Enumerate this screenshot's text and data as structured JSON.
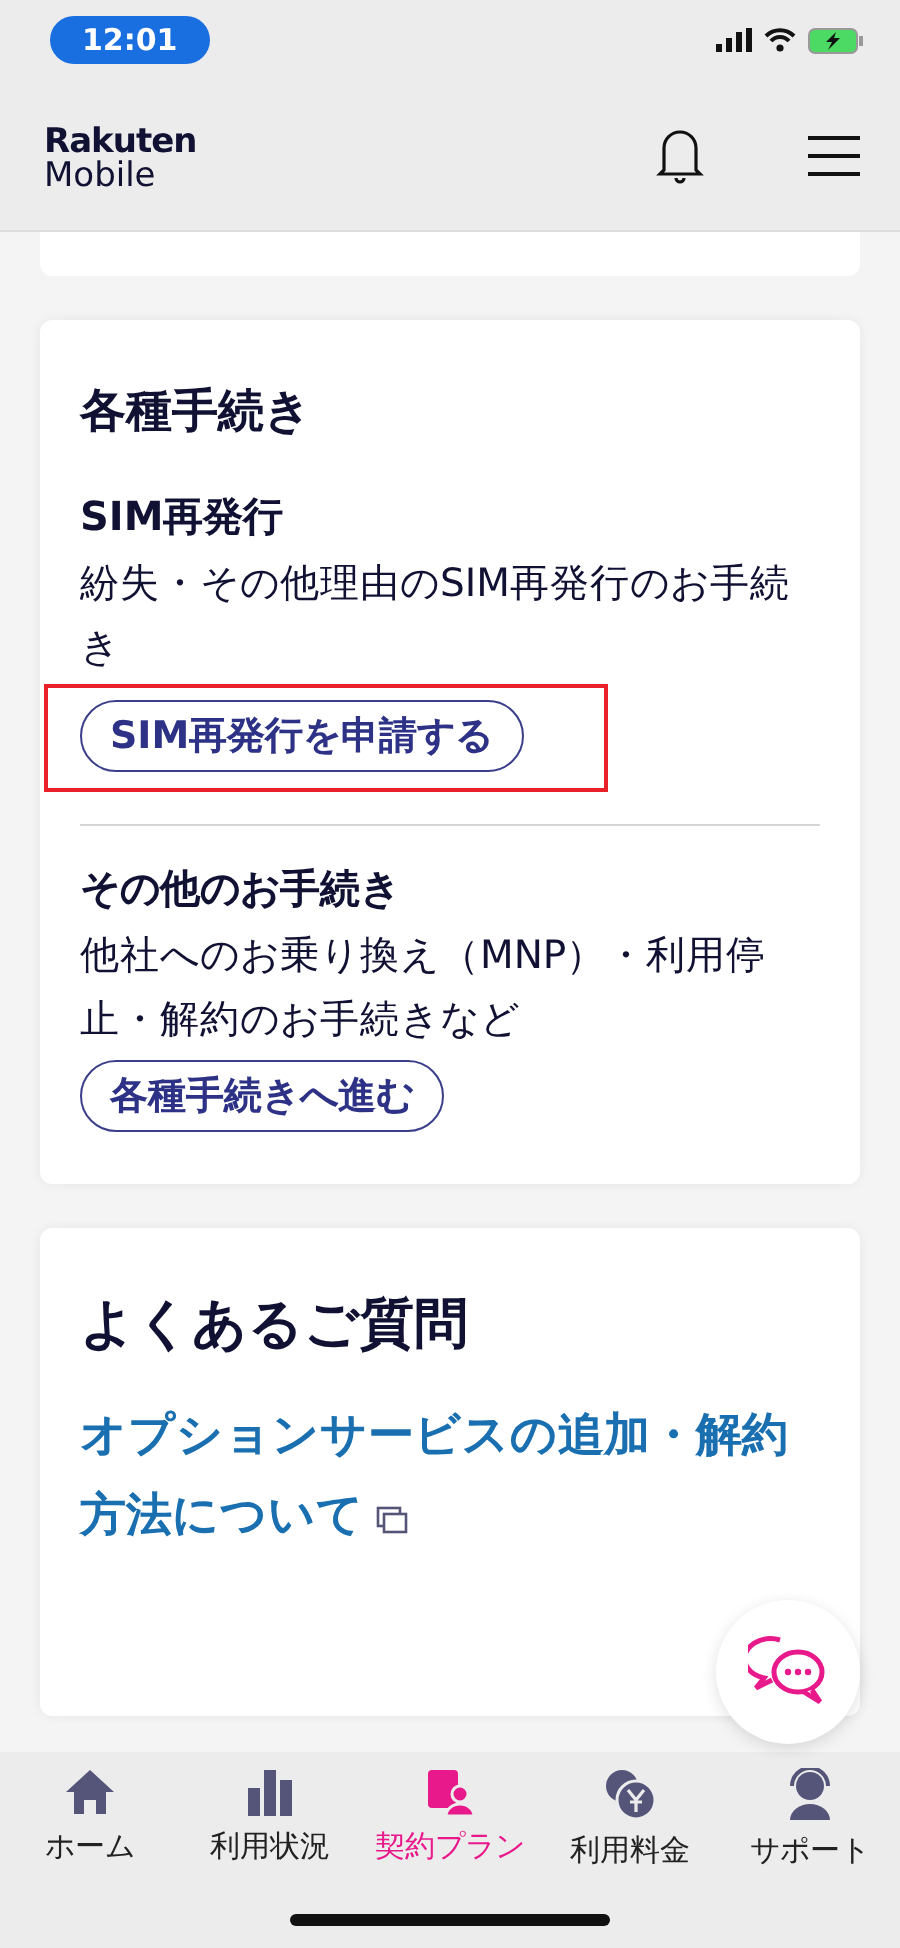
{
  "status_bar": {
    "time": "12:01"
  },
  "header": {
    "logo_top": "Rakuten",
    "logo_bottom": "Mobile"
  },
  "procedures": {
    "title": "各種手続き",
    "sections": [
      {
        "heading": "SIM再発行",
        "description": "紛失・その他理由のSIM再発行のお手続き",
        "button": "SIM再発行を申請する",
        "highlighted": true
      },
      {
        "heading": "その他のお手続き",
        "description": "他社へのお乗り換え（MNP）・利用停止・解約のお手続きなど",
        "button": "各種手続きへ進む",
        "highlighted": false
      }
    ]
  },
  "faq": {
    "title": "よくあるご質問",
    "links": [
      {
        "text": "オプションサービスの追加・解約方法について",
        "external": true
      }
    ]
  },
  "tabs": [
    {
      "label": "ホーム",
      "kind": "home",
      "selected": false
    },
    {
      "label": "利用状況",
      "kind": "usage",
      "selected": false
    },
    {
      "label": "契約プラン",
      "kind": "plan",
      "selected": true
    },
    {
      "label": "利用料金",
      "kind": "fee",
      "selected": false
    },
    {
      "label": "サポート",
      "kind": "support",
      "selected": false
    }
  ]
}
